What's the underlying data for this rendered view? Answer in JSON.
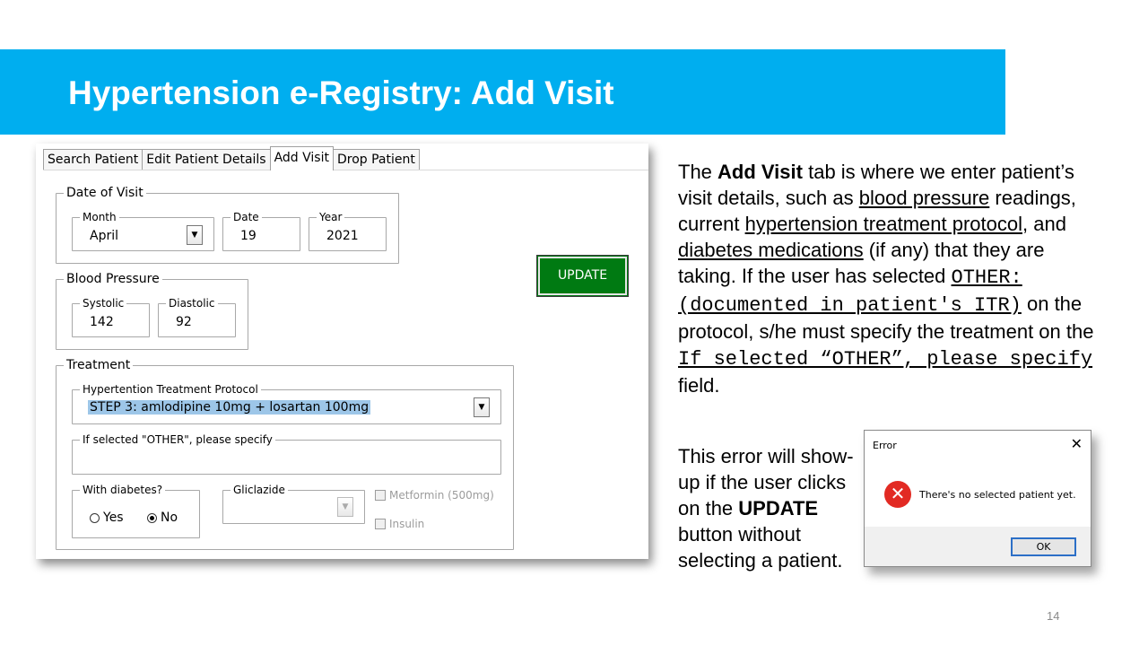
{
  "slide": {
    "title": "Hypertension e-Registry: Add Visit",
    "page_number": "14"
  },
  "form": {
    "tabs": [
      "Search Patient",
      "Edit Patient Details",
      "Add Visit",
      "Drop Patient"
    ],
    "active_tab": "Add Visit",
    "date_of_visit": {
      "label": "Date of Visit",
      "month_label": "Month",
      "month_value": "April",
      "date_label": "Date",
      "date_value": "19",
      "year_label": "Year",
      "year_value": "2021"
    },
    "update_button": "UPDATE",
    "blood_pressure": {
      "label": "Blood Pressure",
      "systolic_label": "Systolic",
      "systolic_value": "142",
      "diastolic_label": "Diastolic",
      "diastolic_value": "92"
    },
    "treatment": {
      "label": "Treatment",
      "protocol_label": "Hypertention Treatment Protocol",
      "protocol_value": "STEP 3: amlodipine 10mg + losartan 100mg",
      "other_label": "If selected \"OTHER\", please specify",
      "other_value": "",
      "diabetes_label": "With diabetes?",
      "yes_label": "Yes",
      "no_label": "No",
      "diabetes_selected": "No",
      "gliclazide_label": "Gliclazide",
      "metformin_label": "Metformin (500mg)",
      "insulin_label": "Insulin"
    }
  },
  "description": {
    "p1_a": "The ",
    "p1_b": "Add Visit",
    "p1_c": " tab is where we enter patient’s visit details, such as ",
    "p1_d": "blood pressure",
    "p1_e": " readings, current ",
    "p1_f": "hypertension treatment protocol",
    "p1_g": ", and ",
    "p1_h": "diabetes medications",
    "p1_i": " (if any) that they are taking. If the user has selected ",
    "p1_j": "OTHER: (documented in patient's ITR)",
    "p1_k": " on the protocol, s/he must specify the treatment on the ",
    "p1_l": "If selected “OTHER”, please specify",
    "p1_m": " field.",
    "p2_a": "This error will show-up if the user clicks on the ",
    "p2_b": "UPDATE",
    "p2_c": " button without selecting a patient."
  },
  "dialog": {
    "title": "Error",
    "close": "✕",
    "icon": "error-icon",
    "message": "There's no selected patient yet.",
    "ok": "OK"
  }
}
